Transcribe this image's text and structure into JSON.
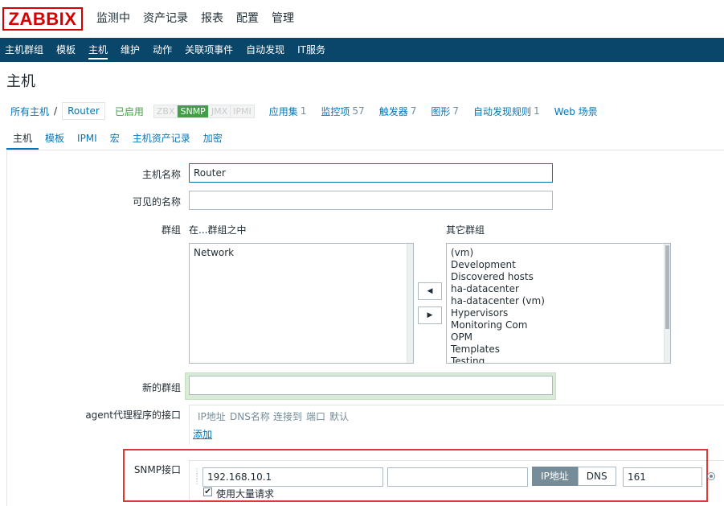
{
  "header": {
    "logo": "ZABBIX",
    "menu": [
      "监测中",
      "资产记录",
      "报表",
      "配置",
      "管理"
    ]
  },
  "subnav": [
    "主机群组",
    "模板",
    "主机",
    "维护",
    "动作",
    "关联项事件",
    "自动发现",
    "IT服务"
  ],
  "page": {
    "title": "主机"
  },
  "breadcrumb": {
    "all_hosts": "所有主机",
    "separator": "/",
    "current": "Router",
    "status": "已启用",
    "availability": [
      "ZBX",
      "SNMP",
      "JMX",
      "IPMI"
    ],
    "links": [
      {
        "label": "应用集",
        "count": "1"
      },
      {
        "label": "监控项",
        "count": "57"
      },
      {
        "label": "触发器",
        "count": "7"
      },
      {
        "label": "图形",
        "count": "7"
      },
      {
        "label": "自动发现规则",
        "count": "1"
      },
      {
        "label": "Web 场景",
        "count": ""
      }
    ]
  },
  "tabs": [
    "主机",
    "模板",
    "IPMI",
    "宏",
    "主机资产记录",
    "加密"
  ],
  "form": {
    "host_name_label": "主机名称",
    "host_name_value": "Router",
    "visible_name_label": "可见的名称",
    "visible_name_value": "",
    "groups_label": "群组",
    "in_groups_label": "在...群组之中",
    "other_groups_label": "其它群组",
    "in_groups": [
      "Network"
    ],
    "other_groups": [
      "(vm)",
      "Development",
      "Discovered hosts",
      "ha-datacenter",
      "ha-datacenter (vm)",
      "Hypervisors",
      "Monitoring Com",
      "OPM",
      "Templates",
      "Testing"
    ],
    "move_left": "◀",
    "move_right": "▶",
    "new_group_label": "新的群组",
    "new_group_value": "",
    "agent_label": "agent代理程序的接口",
    "agent_headers": [
      "IP地址",
      "DNS名称",
      "连接到",
      "端口",
      "默认"
    ],
    "add_link": "添加",
    "snmp_label": "SNMP接口",
    "snmp_ip": "192.168.10.1",
    "snmp_dns": "",
    "connect_ip": "IP地址",
    "connect_dns": "DNS",
    "snmp_port": "161",
    "bulk_label": "使用大量请求",
    "bulk_checked": "✔"
  }
}
